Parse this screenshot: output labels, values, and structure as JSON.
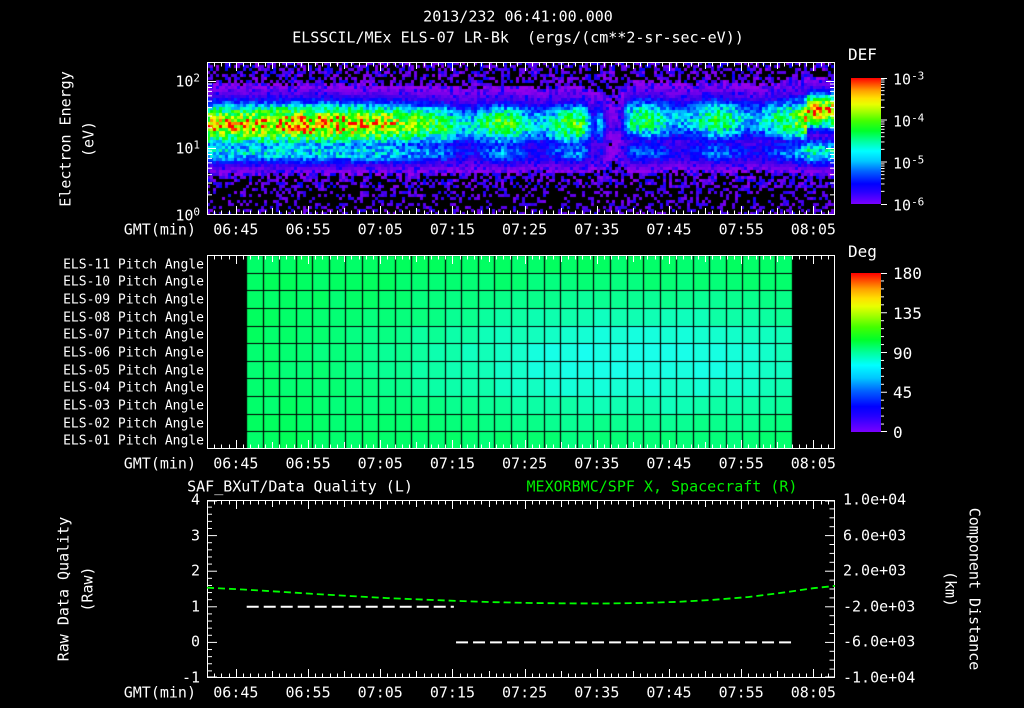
{
  "window": {
    "background": "#000000"
  },
  "title": {
    "datetime": "2013/232 06:41:00.000",
    "instrument": "ELSSCIL/MEx ELS-07 LR-Bk  (ergs/(cm**2-sr-sec-eV))"
  },
  "colors": {
    "text": "#ffffff",
    "frame": "#ffffff",
    "title_green": "#00ee00",
    "curve_green": "#00ff00",
    "quality_white": "#ffffff",
    "colorbar_top": "#ff0000",
    "colorbar_bottom": "#7a00ff"
  },
  "time_axis": {
    "label": "GMT(min)",
    "start_time": "06:41:00.000",
    "tick_labels": [
      "06:45",
      "06:55",
      "07:05",
      "07:15",
      "07:25",
      "07:35",
      "07:45",
      "07:55",
      "08:05"
    ],
    "tick_minutes": [
      4,
      14,
      24,
      34,
      44,
      54,
      64,
      74,
      84
    ],
    "total_minutes": 87
  },
  "spectrogram_panel": {
    "ylabel": "Electron Energy",
    "ylabel_units": "(eV)",
    "ytick_labels": [
      {
        "base": "10",
        "exp": "2"
      },
      {
        "base": "10",
        "exp": "1"
      },
      {
        "base": "10",
        "exp": "0"
      }
    ],
    "colorbar": {
      "title": "DEF",
      "tick_labels": [
        {
          "base": "10",
          "exp": "-3"
        },
        {
          "base": "10",
          "exp": "-4"
        },
        {
          "base": "10",
          "exp": "-5"
        },
        {
          "base": "10",
          "exp": "-6"
        }
      ]
    }
  },
  "pitch_panel": {
    "row_labels": [
      "ELS-11 Pitch Angle",
      "ELS-10 Pitch Angle",
      "ELS-09 Pitch Angle",
      "ELS-08 Pitch Angle",
      "ELS-07 Pitch Angle",
      "ELS-06 Pitch Angle",
      "ELS-05 Pitch Angle",
      "ELS-04 Pitch Angle",
      "ELS-03 Pitch Angle",
      "ELS-02 Pitch Angle",
      "ELS-01 Pitch Angle"
    ],
    "colorbar": {
      "title": "Deg",
      "tick_labels": [
        "180",
        "135",
        "90",
        "45",
        "0"
      ]
    }
  },
  "timeseries_panel": {
    "title_left": "SAF_BXuT/Data Quality (L)",
    "title_right": "MEXORBMC/SPF X, Spacecraft (R)",
    "ylabel_left": "Raw Data Quality",
    "ylabel_left_units": "(Raw)",
    "ylabel_right": "Component Distance",
    "ylabel_right_units": "(km)",
    "ytick_labels_left": [
      "4",
      "3",
      "2",
      "1",
      "0",
      "-1"
    ],
    "ytick_labels_right": [
      "1.0e+04",
      "6.0e+03",
      "2.0e+03",
      "-2.0e+03",
      "-6.0e+03",
      "-1.0e+04"
    ]
  },
  "chart_data": [
    {
      "type": "heatmap",
      "name": "electron_energy_spectrogram",
      "title": "ELSSCIL/MEx ELS-07 LR-Bk",
      "units": "ergs/(cm**2-sr-sec-eV)",
      "x_axis": {
        "label": "GMT(min)",
        "start": "06:41",
        "end": "08:08",
        "tick_labels": [
          "06:45",
          "06:55",
          "07:05",
          "07:15",
          "07:25",
          "07:35",
          "07:45",
          "07:55",
          "08:05"
        ]
      },
      "y_axis": {
        "label": "Electron Energy (eV)",
        "scale": "log",
        "min": 1,
        "max": 190
      },
      "z_axis": {
        "label": "DEF",
        "min": 1e-06,
        "max": 0.001
      },
      "features": {
        "main_band": {
          "center_frac_from_top": 0.4,
          "width_frac": 0.145,
          "peak_def_approx": 0.0002,
          "description": "bright green-yellow electron flux band ~8-50 eV, brightest 06:41-07:10"
        },
        "band_amplitude_profile": [
          [
            0.0,
            0.8
          ],
          [
            0.28,
            0.78
          ],
          [
            0.36,
            0.62
          ],
          [
            0.6,
            0.62
          ],
          [
            0.612,
            0.3
          ],
          [
            0.625,
            0.55
          ],
          [
            0.638,
            0.12
          ],
          [
            0.655,
            0.12
          ],
          [
            0.668,
            0.55
          ],
          [
            0.93,
            0.58
          ],
          [
            0.955,
            0.88
          ],
          [
            1.0,
            0.88
          ]
        ],
        "data_gap_time_frac": 0.645,
        "background": "blue speckle noise above/below band, black below ~3 eV"
      }
    },
    {
      "type": "heatmap",
      "name": "pitch_angle_panel",
      "rows": 11,
      "columns": 33,
      "x_axis": {
        "label": "GMT(min)",
        "data_start_frac": 0.062,
        "data_end_frac": 0.931,
        "data_start": "06:46",
        "data_end": "07:58"
      },
      "z_axis": {
        "label": "Deg",
        "min": 0,
        "max": 180
      },
      "value_model": {
        "base_deg": 97,
        "cyan_dip_deg": 72,
        "dip_center_row": 5.5,
        "dip_row_sigma": 3.4,
        "dip_center_col_frac": 0.72,
        "dip_col_sigma": 0.45,
        "description": "green ~95-100 deg cells, shifting cyan ~70-80 deg for mid sectors toward 07:25-07:55"
      }
    },
    {
      "type": "line",
      "name": "quality_and_distance",
      "x_axis": {
        "label": "GMT(min)",
        "start": "06:41",
        "end": "08:08",
        "total_minutes": 87
      },
      "y_left": {
        "label": "Raw Data Quality (Raw)",
        "min": -1,
        "max": 4
      },
      "y_right": {
        "label": "Component Distance (km)",
        "min": -10000,
        "max": 10000
      },
      "series": [
        {
          "name": "SAF_BXuT/Data Quality",
          "axis": "left",
          "color": "#ffffff",
          "style": "dashed",
          "segments": [
            {
              "t_start_min": 5.5,
              "t_end_min": 34.2,
              "value": 1
            },
            {
              "t_start_min": 34.5,
              "t_end_min": 81.0,
              "value": 0
            }
          ]
        },
        {
          "name": "MEXORBMC/SPF X Spacecraft",
          "axis": "right",
          "color": "#00ff00",
          "style": "dashed",
          "points_min_km": [
            [
              0,
              150
            ],
            [
              5,
              -60
            ],
            [
              10,
              -300
            ],
            [
              15,
              -560
            ],
            [
              20,
              -800
            ],
            [
              25,
              -1020
            ],
            [
              30,
              -1190
            ],
            [
              35,
              -1350
            ],
            [
              40,
              -1480
            ],
            [
              45,
              -1570
            ],
            [
              50,
              -1620
            ],
            [
              55,
              -1630
            ],
            [
              60,
              -1570
            ],
            [
              65,
              -1450
            ],
            [
              70,
              -1230
            ],
            [
              75,
              -900
            ],
            [
              80,
              -380
            ],
            [
              84,
              90
            ],
            [
              87,
              350
            ]
          ]
        }
      ]
    }
  ]
}
